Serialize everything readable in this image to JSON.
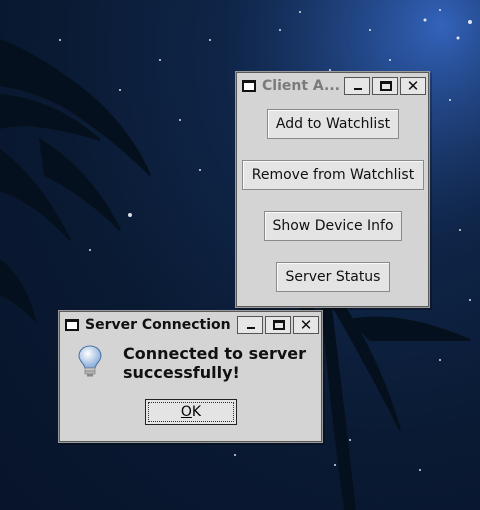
{
  "client_window": {
    "title": "Client A...",
    "buttons": {
      "add": "Add to Watchlist",
      "remove": "Remove from Watchlist",
      "device": "Show Device Info",
      "status": "Server Status"
    }
  },
  "dialog": {
    "title": "Server Connection",
    "message": "Connected to server successfully!",
    "ok_mnemonic": "O",
    "ok_rest": "K",
    "icon": "lightbulb-icon"
  },
  "titlebar_controls": {
    "close_glyph": "✕"
  }
}
